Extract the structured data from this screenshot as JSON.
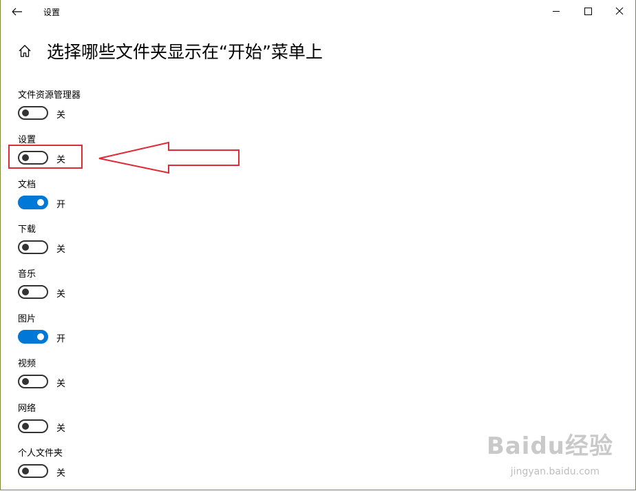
{
  "window": {
    "title": "设置"
  },
  "page": {
    "title": "选择哪些文件夹显示在“开始”菜单上"
  },
  "items": [
    {
      "label": "文件资源管理器",
      "state": "关",
      "on": false
    },
    {
      "label": "设置",
      "state": "关",
      "on": false
    },
    {
      "label": "文档",
      "state": "开",
      "on": true
    },
    {
      "label": "下载",
      "state": "关",
      "on": false
    },
    {
      "label": "音乐",
      "state": "关",
      "on": false
    },
    {
      "label": "图片",
      "state": "开",
      "on": true
    },
    {
      "label": "视频",
      "state": "关",
      "on": false
    },
    {
      "label": "网络",
      "state": "关",
      "on": false
    },
    {
      "label": "个人文件夹",
      "state": "关",
      "on": false
    }
  ],
  "watermark": {
    "main": "Baidu经验",
    "sub": "jingyan.baidu.com"
  },
  "colors": {
    "accent": "#0078d7",
    "annotation": "#e02a35"
  },
  "icons": {
    "back": "back-arrow-icon",
    "home": "home-icon",
    "minimize": "minimize-icon",
    "maximize": "maximize-icon",
    "close": "close-icon"
  }
}
